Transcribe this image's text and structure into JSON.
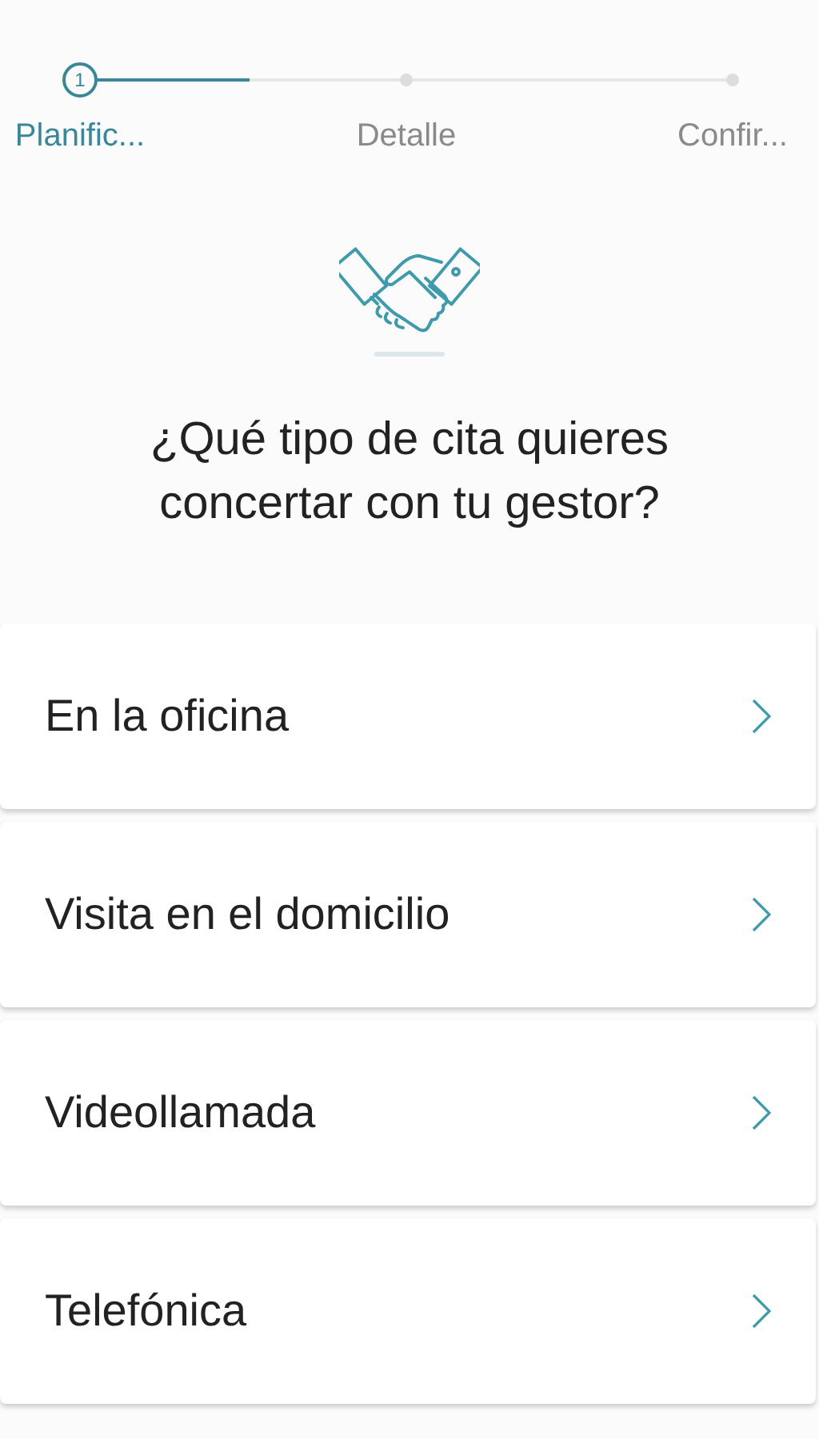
{
  "stepper": {
    "level": 0.25,
    "steps": [
      {
        "number": "1",
        "label": "Planific...",
        "selected": true
      },
      {
        "label": "Detalle",
        "selected": false
      },
      {
        "label": "Confir...",
        "selected": false
      }
    ]
  },
  "question": "¿Qué tipo de cita quieres concertar con tu gestor?",
  "options": [
    {
      "label": "En la oficina"
    },
    {
      "label": "Visita en el domicilio"
    },
    {
      "label": "Videollamada"
    },
    {
      "label": "Telefónica"
    }
  ]
}
